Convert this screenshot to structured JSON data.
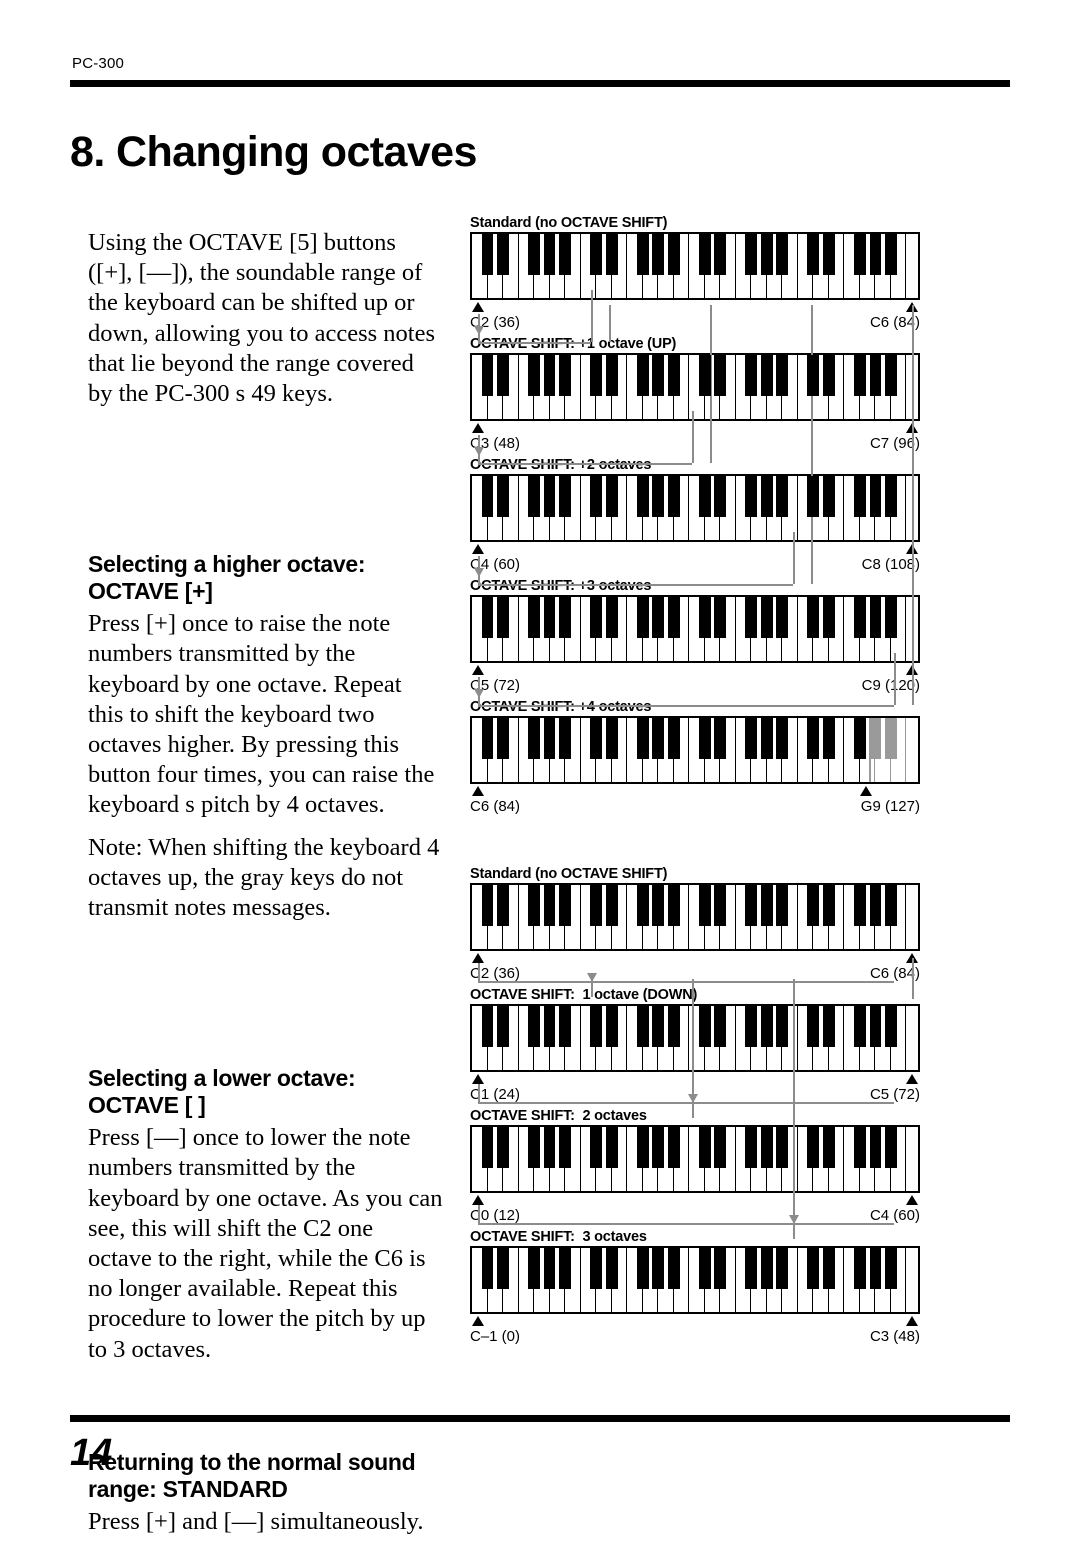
{
  "header": {
    "product": "PC-300"
  },
  "title": "8. Changing octaves",
  "page_number": "14",
  "body": {
    "intro": "Using the OCTAVE [5] buttons ([+], [—]), the soundable range of the keyboard can be shifted up or down, allowing you to access notes that lie beyond the range covered by the PC-300 s 49 keys.",
    "higher_heading": "Selecting a higher octave: OCTAVE [+]",
    "higher_p1": "Press [+] once to raise the note numbers transmitted by the keyboard by one octave. Repeat this to shift the keyboard two octaves higher. By pressing this button four times, you can raise the keyboard s pitch by 4 octaves.",
    "higher_note": "Note: When shifting the keyboard 4 octaves up, the gray keys do not transmit notes messages.",
    "lower_heading": "Selecting a lower octave: OCTAVE [ ]",
    "lower_p1": "Press [—] once to lower the note numbers transmitted by the keyboard by one octave. As you can see, this will shift the C2 one octave to the right, while the C6 is no longer available. Repeat this procedure to lower the pitch by up to 3 octaves.",
    "standard_heading": "Returning to the normal sound range: STANDARD",
    "standard_p1": "Press [+] and [—] simultaneously."
  },
  "figures": {
    "upper": [
      {
        "caption": "Standard (no OCTAVE SHIFT)",
        "low": "C2 (36)",
        "high": "C6 (84)",
        "gray": false
      },
      {
        "caption": "OCTAVE SHIFT: +1 octave (UP)",
        "low": "C3 (48)",
        "high": "C7 (96)",
        "gray": false
      },
      {
        "caption": "OCTAVE SHIFT: +2 octaves",
        "low": "C4 (60)",
        "high": "C8 (108)",
        "gray": false
      },
      {
        "caption": "OCTAVE SHIFT: +3 octaves",
        "low": "C5 (72)",
        "high": "C9 (120)",
        "gray": false
      },
      {
        "caption": "OCTAVE SHIFT: +4 octaves",
        "low": "C6 (84)",
        "high": "G9 (127)",
        "gray": true
      }
    ],
    "lower": [
      {
        "caption": "Standard (no OCTAVE SHIFT)",
        "low": "C2 (36)",
        "high": "C6 (84)",
        "gray": false
      },
      {
        "caption": "OCTAVE SHIFT:  1 octave (DOWN)",
        "low": "C1 (24)",
        "high": "C5 (72)",
        "gray": false
      },
      {
        "caption": "OCTAVE SHIFT:  2 octaves",
        "low": "C0 (12)",
        "high": "C4 (60)",
        "gray": false
      },
      {
        "caption": "OCTAVE SHIFT:  3 octaves",
        "low": "C–1 (0)",
        "high": "C3 (48)",
        "gray": false
      }
    ]
  },
  "colors": {
    "ink": "#000000",
    "gray_key": "#9a9a9a",
    "connector": "#8c8c8c"
  },
  "keyboard": {
    "white_key_count": 29,
    "key_total": 49,
    "note": "4 octaves plus top C, C2–C6 in standard"
  }
}
